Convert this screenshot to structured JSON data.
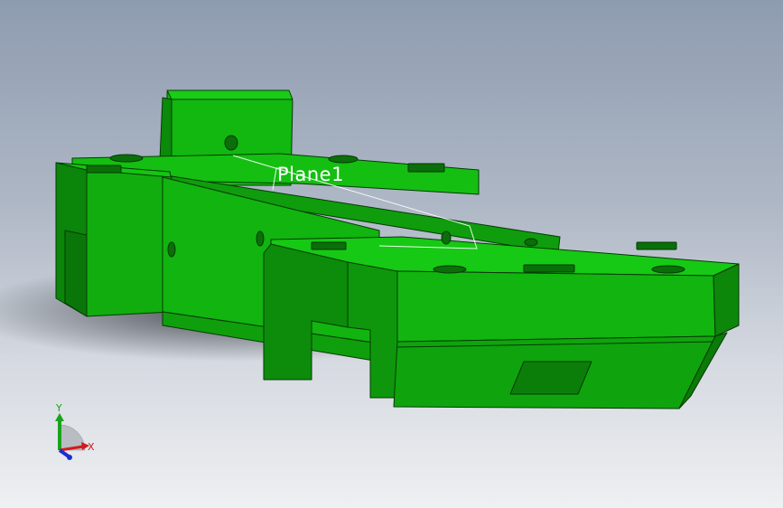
{
  "viewport": {
    "plane_label": "Plane1",
    "part_color": "#10b20e",
    "part_dark_color": "#0b7d0a",
    "part_light_color": "#15c513"
  },
  "triad": {
    "x_label": "X",
    "y_label": "Y",
    "x_color": "#d11b1b",
    "y_color": "#1aa31a",
    "z_color": "#1a2fd1"
  }
}
